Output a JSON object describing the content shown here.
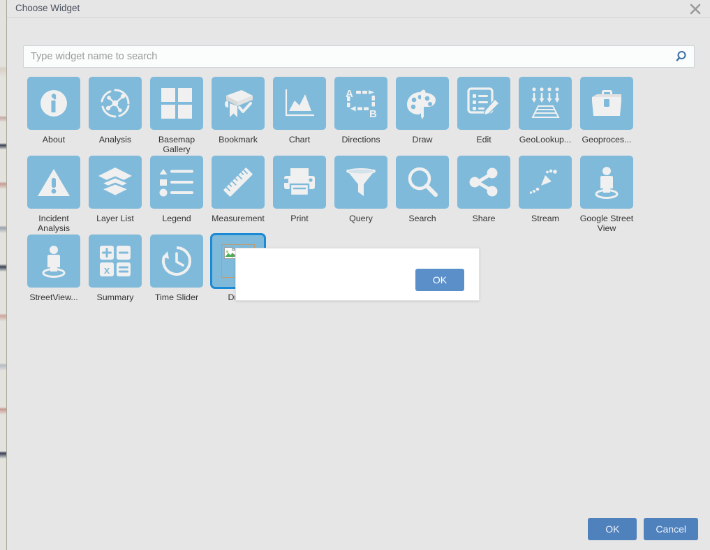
{
  "dialog": {
    "title": "Choose Widget",
    "close_icon": "close-icon"
  },
  "search": {
    "placeholder": "Type widget name to search",
    "value": "",
    "icon": "search-icon"
  },
  "widgets": [
    {
      "label": "About",
      "icon": "info-icon",
      "selected": false
    },
    {
      "label": "Analysis",
      "icon": "analysis-network-icon",
      "selected": false
    },
    {
      "label": "Basemap Gallery",
      "icon": "grid-squares-icon",
      "selected": false
    },
    {
      "label": "Bookmark",
      "icon": "bookmark-icon",
      "selected": false
    },
    {
      "label": "Chart",
      "icon": "chart-icon",
      "selected": false
    },
    {
      "label": "Directions",
      "icon": "directions-a-b-icon",
      "selected": false
    },
    {
      "label": "Draw",
      "icon": "palette-brush-icon",
      "selected": false
    },
    {
      "label": "Edit",
      "icon": "edit-pencil-icon",
      "selected": false
    },
    {
      "label": "GeoLookup...",
      "icon": "geolookup-icon",
      "selected": false
    },
    {
      "label": "Geoproces...",
      "icon": "toolbox-icon",
      "selected": false
    },
    {
      "label": "Incident Analysis",
      "icon": "warning-triangle-icon",
      "selected": false
    },
    {
      "label": "Layer List",
      "icon": "layers-icon",
      "selected": false
    },
    {
      "label": "Legend",
      "icon": "legend-list-icon",
      "selected": false
    },
    {
      "label": "Measurement",
      "icon": "ruler-icon",
      "selected": false
    },
    {
      "label": "Print",
      "icon": "printer-icon",
      "selected": false
    },
    {
      "label": "Query",
      "icon": "funnel-icon",
      "selected": false
    },
    {
      "label": "Search",
      "icon": "magnifier-icon",
      "selected": false
    },
    {
      "label": "Share",
      "icon": "share-nodes-icon",
      "selected": false
    },
    {
      "label": "Stream",
      "icon": "stream-dots-icon",
      "selected": false
    },
    {
      "label": "Google Street View",
      "icon": "street-view-person-icon",
      "selected": false
    },
    {
      "label": "StreetView...",
      "icon": "street-view-person-icon",
      "selected": false
    },
    {
      "label": "Summary",
      "icon": "calculator-icon",
      "selected": false
    },
    {
      "label": "Time Slider",
      "icon": "clock-history-icon",
      "selected": false
    },
    {
      "label": "Draw",
      "icon": "broken-image-icon",
      "selected": true
    }
  ],
  "inner_modal": {
    "message": "",
    "ok_label": "OK"
  },
  "footer": {
    "ok_label": "OK",
    "cancel_label": "Cancel"
  },
  "colors": {
    "tile": "#7fbada",
    "selection": "#1b8ad6",
    "dialog_bg": "#e6e6e6",
    "button": "#4f81bd",
    "modal_button": "#5b8fc9"
  }
}
